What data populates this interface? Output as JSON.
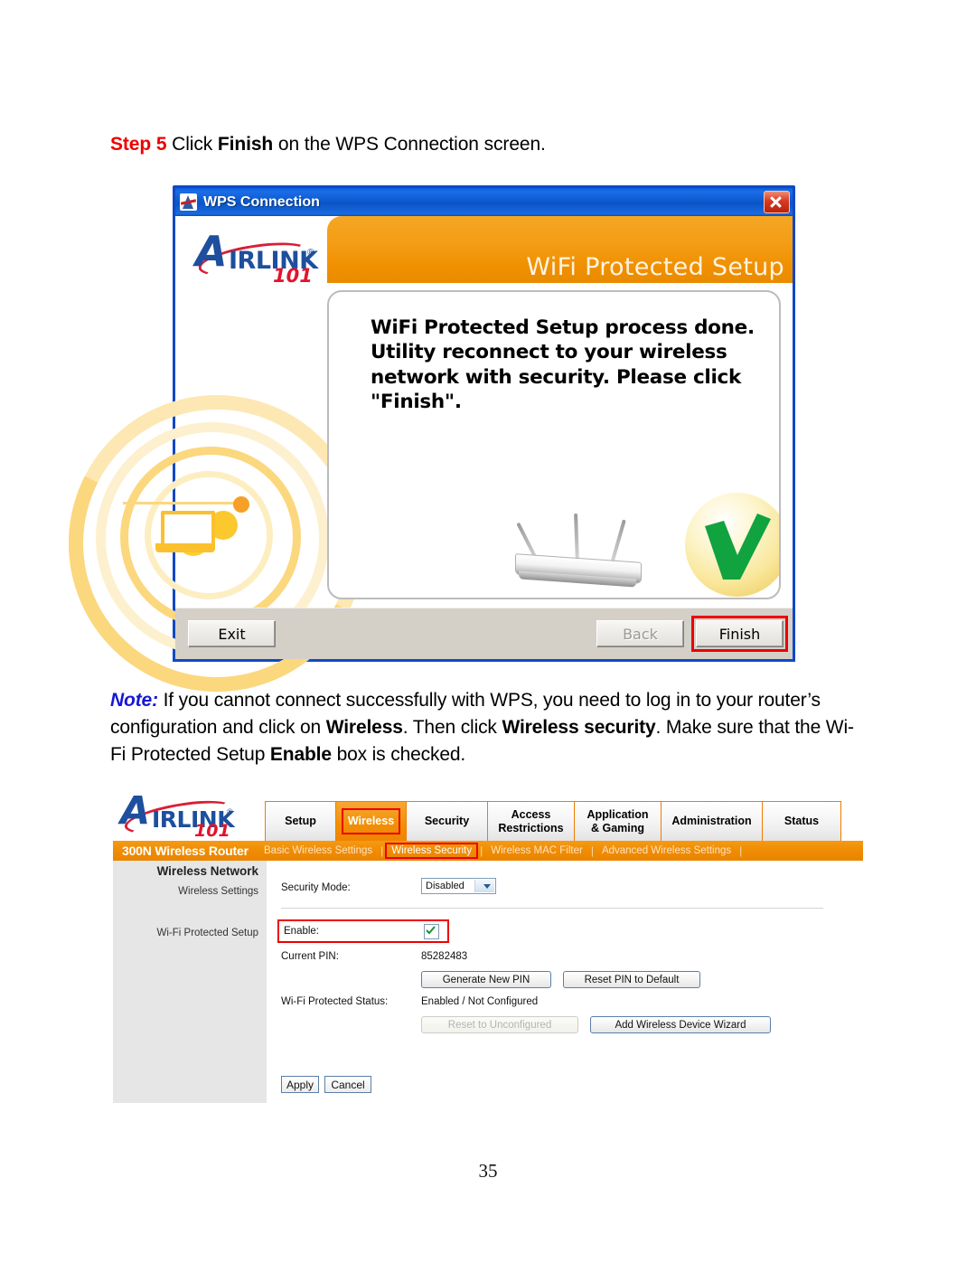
{
  "step": {
    "label": "Step 5",
    "text_before": " Click ",
    "bold_word": "Finish",
    "text_after": " on the WPS Connection screen."
  },
  "wps_dialog": {
    "title": "WPS Connection",
    "title_icon": "airlink-app-icon",
    "close_icon": "close-icon",
    "banner_title": "WiFi Protected Setup",
    "logo": {
      "letter": "A",
      "word": "IRLINK",
      "registered": "®",
      "number": "101"
    },
    "message": "WiFi Protected Setup process done. Utility reconnect to your wireless network with security. Please click \"Finish\".",
    "buttons": {
      "exit": "Exit",
      "back": "Back",
      "finish": "Finish"
    },
    "highlight_color": "#ee0000",
    "titlebar_color": "#1248c4",
    "banner_color": "#f09000"
  },
  "note": {
    "label": "Note:",
    "part1": " If you cannot connect successfully with WPS, you need to log in to your router’s configuration and click on ",
    "bold1": "Wireless",
    "part2": ".  Then click ",
    "bold2": "Wireless security",
    "part3": ".  Make sure that the Wi-Fi Protected Setup ",
    "bold3": "Enable",
    "part4": " box is checked.",
    "label_color": "#1717d8"
  },
  "router_ui": {
    "logo": {
      "letter": "A",
      "word": "IRLINK",
      "registered": "®",
      "number": "101"
    },
    "tabs": [
      {
        "label": "Setup",
        "active": false
      },
      {
        "label": "Wireless",
        "active": true
      },
      {
        "label": "Security",
        "active": false
      },
      {
        "label": "Access Restrictions",
        "active": false
      },
      {
        "label": "Application & Gaming",
        "active": false
      },
      {
        "label": "Administration",
        "active": false
      },
      {
        "label": "Status",
        "active": false
      }
    ],
    "model": "300N Wireless Router",
    "subnav": [
      {
        "label": "Basic Wireless Settings",
        "active": false
      },
      {
        "label": "Wireless Security",
        "active": true
      },
      {
        "label": "Wireless MAC Filter",
        "active": false
      },
      {
        "label": "Advanced Wireless Settings",
        "active": false
      }
    ],
    "sidebar": {
      "heading": "Wireless Network",
      "items": [
        {
          "label": "Wireless Settings"
        },
        {
          "label": "Wi-Fi Protected Setup"
        }
      ]
    },
    "form": {
      "security_mode_label": "Security Mode:",
      "security_mode_value": "Disabled",
      "enable_label": "Enable:",
      "enable_checked": true,
      "current_pin_label": "Current PIN:",
      "current_pin_value": "85282483",
      "generate_pin_button": "Generate New PIN",
      "reset_pin_button": "Reset PIN to Default",
      "status_label": "Wi-Fi Protected Status:",
      "status_value": "Enabled / Not Configured",
      "reset_unconfigured_button": "Reset to Unconfigured",
      "add_device_button": "Add Wireless Device Wizard",
      "apply_button": "Apply",
      "cancel_button": "Cancel"
    },
    "accent_color": "#ef8b02",
    "highlight_color": "#ee0000"
  },
  "page_number": "35"
}
